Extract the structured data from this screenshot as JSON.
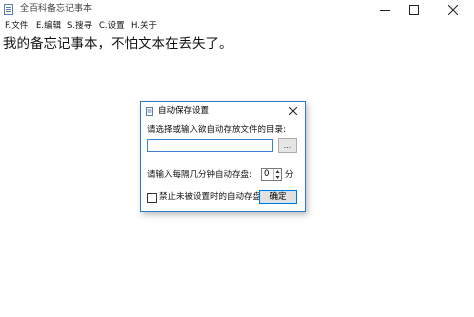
{
  "window": {
    "title": "全百科备忘记事本"
  },
  "menu": {
    "items": [
      "F.文件",
      "E.编辑",
      "S.搜寻",
      "C.设置",
      "H.关于"
    ]
  },
  "editor": {
    "text": "我的备忘记事本，不怕文本在丢失了。"
  },
  "dialog": {
    "title": "自动保存设置",
    "dir_prompt": "请选择或输入欲自动存放文件的目录:",
    "dir_value": "",
    "browse_label": "...",
    "interval_prompt": "请输入每隔几分钟自动存盘:",
    "interval_value": "0",
    "interval_unit": "分",
    "disable_label": "禁止未被设置时的自动存盘",
    "disable_checked": false,
    "ok_label": "确定"
  },
  "colors": {
    "dialog_border": "#2b78c9",
    "input_border": "#3a7fd0",
    "ok_border": "#0078d7"
  }
}
